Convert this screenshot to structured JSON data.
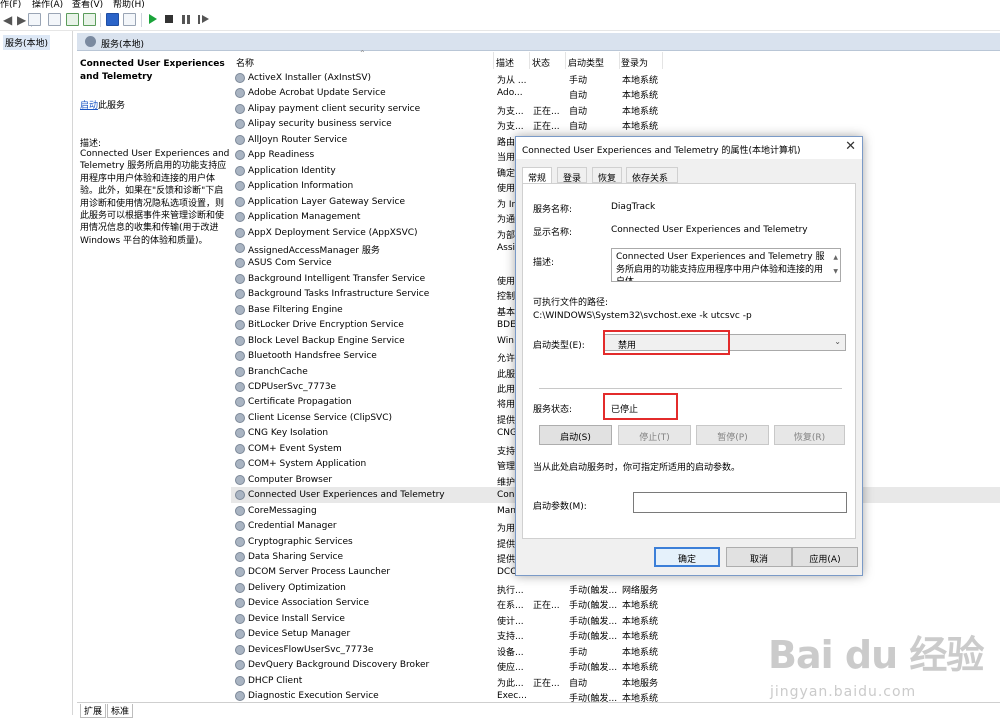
{
  "menubar": {
    "items": [
      "作(F)",
      "操作(A)",
      "查看(V)",
      "帮助(H)"
    ]
  },
  "tree": {
    "root": "服务(本地)"
  },
  "header": {
    "title": "服务(本地)"
  },
  "left_panel": {
    "service_title": "Connected User Experiences and Telemetry",
    "start_link": "启动",
    "start_suffix": "此服务",
    "desc_label": "描述:",
    "description": "Connected User Experiences and Telemetry 服务所启用的功能支持应用程序中用户体验和连接的用户体验。此外，如果在\"反馈和诊断\"下启用诊断和使用情况隐私选项设置，则此服务可以根据事件来管理诊断和使用情况信息的收集和传输(用于改进 Windows 平台的体验和质量)。"
  },
  "columns": {
    "name": "名称",
    "desc": "描述",
    "status": "状态",
    "startup": "启动类型",
    "logon": "登录为"
  },
  "services": [
    {
      "name": "ActiveX Installer (AxInstSV)",
      "desc": "为从 ...",
      "status": "",
      "startup": "手动",
      "logon": "本地系统"
    },
    {
      "name": "Adobe Acrobat Update Service",
      "desc": "Ado...",
      "status": "",
      "startup": "自动",
      "logon": "本地系统"
    },
    {
      "name": "Alipay payment client security service",
      "desc": "为支...",
      "status": "正在...",
      "startup": "自动",
      "logon": "本地系统"
    },
    {
      "name": "Alipay security business service",
      "desc": "为支...",
      "status": "正在...",
      "startup": "自动",
      "logon": "本地系统"
    },
    {
      "name": "AllJoyn Router Service",
      "desc": "路由",
      "status": "",
      "startup": "",
      "logon": ""
    },
    {
      "name": "App Readiness",
      "desc": "当用",
      "status": "",
      "startup": "",
      "logon": ""
    },
    {
      "name": "Application Identity",
      "desc": "确定",
      "status": "",
      "startup": "",
      "logon": ""
    },
    {
      "name": "Application Information",
      "desc": "使用",
      "status": "",
      "startup": "",
      "logon": ""
    },
    {
      "name": "Application Layer Gateway Service",
      "desc": "为 In",
      "status": "",
      "startup": "",
      "logon": ""
    },
    {
      "name": "Application Management",
      "desc": "为通",
      "status": "",
      "startup": "",
      "logon": ""
    },
    {
      "name": "AppX Deployment Service (AppXSVC)",
      "desc": "为部",
      "status": "",
      "startup": "",
      "logon": ""
    },
    {
      "name": "AssignedAccessManager 服务",
      "desc": "Assi",
      "status": "",
      "startup": "",
      "logon": ""
    },
    {
      "name": "ASUS Com Service",
      "desc": "",
      "status": "",
      "startup": "",
      "logon": ""
    },
    {
      "name": "Background Intelligent Transfer Service",
      "desc": "使用",
      "status": "",
      "startup": "",
      "logon": ""
    },
    {
      "name": "Background Tasks Infrastructure Service",
      "desc": "控制",
      "status": "",
      "startup": "",
      "logon": ""
    },
    {
      "name": "Base Filtering Engine",
      "desc": "基本",
      "status": "",
      "startup": "",
      "logon": ""
    },
    {
      "name": "BitLocker Drive Encryption Service",
      "desc": "BDE",
      "status": "",
      "startup": "",
      "logon": ""
    },
    {
      "name": "Block Level Backup Engine Service",
      "desc": "Win",
      "status": "",
      "startup": "",
      "logon": ""
    },
    {
      "name": "Bluetooth Handsfree Service",
      "desc": "允许",
      "status": "",
      "startup": "",
      "logon": ""
    },
    {
      "name": "BranchCache",
      "desc": "此服",
      "status": "",
      "startup": "",
      "logon": ""
    },
    {
      "name": "CDPUserSvc_7773e",
      "desc": "此用",
      "status": "",
      "startup": "",
      "logon": ""
    },
    {
      "name": "Certificate Propagation",
      "desc": "将用",
      "status": "",
      "startup": "",
      "logon": ""
    },
    {
      "name": "Client License Service (ClipSVC)",
      "desc": "提供",
      "status": "",
      "startup": "",
      "logon": ""
    },
    {
      "name": "CNG Key Isolation",
      "desc": "CNG",
      "status": "",
      "startup": "",
      "logon": ""
    },
    {
      "name": "COM+ Event System",
      "desc": "支持",
      "status": "",
      "startup": "",
      "logon": ""
    },
    {
      "name": "COM+ System Application",
      "desc": "管理",
      "status": "",
      "startup": "",
      "logon": ""
    },
    {
      "name": "Computer Browser",
      "desc": "维护",
      "status": "",
      "startup": "",
      "logon": ""
    },
    {
      "name": "Connected User Experiences and Telemetry",
      "desc": "Con",
      "status": "",
      "startup": "",
      "logon": "",
      "selected": true
    },
    {
      "name": "CoreMessaging",
      "desc": "Man",
      "status": "",
      "startup": "",
      "logon": ""
    },
    {
      "name": "Credential Manager",
      "desc": "为用",
      "status": "",
      "startup": "",
      "logon": ""
    },
    {
      "name": "Cryptographic Services",
      "desc": "提供",
      "status": "",
      "startup": "",
      "logon": ""
    },
    {
      "name": "Data Sharing Service",
      "desc": "提供",
      "status": "",
      "startup": "",
      "logon": ""
    },
    {
      "name": "DCOM Server Process Launcher",
      "desc": "DCO",
      "status": "",
      "startup": "",
      "logon": ""
    },
    {
      "name": "Delivery Optimization",
      "desc": "执行...",
      "status": "",
      "startup": "手动(触发...",
      "logon": "网络服务"
    },
    {
      "name": "Device Association Service",
      "desc": "在系...",
      "status": "正在...",
      "startup": "手动(触发...",
      "logon": "本地系统"
    },
    {
      "name": "Device Install Service",
      "desc": "使计...",
      "status": "",
      "startup": "手动(触发...",
      "logon": "本地系统"
    },
    {
      "name": "Device Setup Manager",
      "desc": "支持...",
      "status": "",
      "startup": "手动(触发...",
      "logon": "本地系统"
    },
    {
      "name": "DevicesFlowUserSvc_7773e",
      "desc": "设备...",
      "status": "",
      "startup": "手动",
      "logon": "本地系统"
    },
    {
      "name": "DevQuery Background Discovery Broker",
      "desc": "使应...",
      "status": "",
      "startup": "手动(触发...",
      "logon": "本地系统"
    },
    {
      "name": "DHCP Client",
      "desc": "为此...",
      "status": "正在...",
      "startup": "自动",
      "logon": "本地服务"
    },
    {
      "name": "Diagnostic Execution Service",
      "desc": "Exec...",
      "status": "",
      "startup": "手动(触发...",
      "logon": "本地系统"
    }
  ],
  "bottom_tabs": [
    "扩展",
    "标准"
  ],
  "dialog": {
    "title": "Connected User Experiences and Telemetry 的属性(本地计算机)",
    "tabs": [
      "常规",
      "登录",
      "恢复",
      "依存关系"
    ],
    "service_name_label": "服务名称:",
    "service_name": "DiagTrack",
    "display_name_label": "显示名称:",
    "display_name": "Connected User Experiences and Telemetry",
    "desc_label": "描述:",
    "description": "Connected User Experiences and Telemetry 服务所启用的功能支持应用程序中用户体验和连接的用户体",
    "path_label": "可执行文件的路径:",
    "path": "C:\\WINDOWS\\System32\\svchost.exe -k utcsvc -p",
    "startup_type_label": "启动类型(E):",
    "startup_type": "禁用",
    "status_label": "服务状态:",
    "status": "已停止",
    "buttons": {
      "start": "启动(S)",
      "stop": "停止(T)",
      "pause": "暂停(P)",
      "resume": "恢复(R)"
    },
    "hint": "当从此处启动服务时，你可指定所适用的启动参数。",
    "param_label": "启动参数(M):",
    "param_value": "",
    "ok": "确定",
    "cancel": "取消",
    "apply": "应用(A)"
  },
  "watermark": {
    "brand": "Bai du 经验",
    "url": "jingyan.baidu.com"
  },
  "colors": {
    "highlight_box": "#e32b2b",
    "link": "#1a55c4",
    "selected_row": "#e8e8e8"
  }
}
